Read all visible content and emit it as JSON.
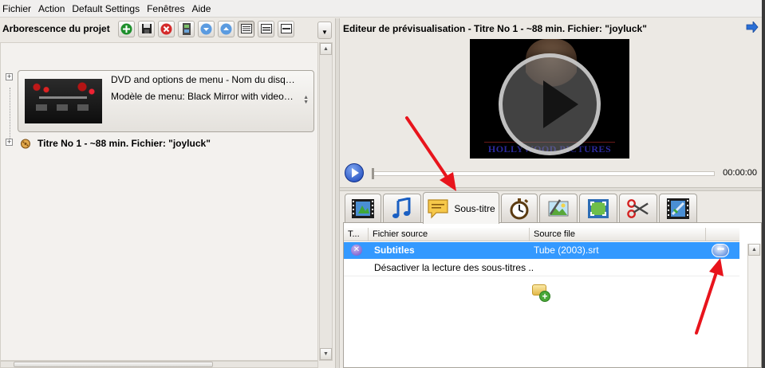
{
  "menubar": {
    "items": [
      "Fichier",
      "Action",
      "Default Settings",
      "Fenêtres",
      "Aide"
    ]
  },
  "project_tree": {
    "title": "Arborescence du projet",
    "toolbar_icons": [
      "add-icon",
      "save-icon",
      "delete-icon",
      "film-strip-icon",
      "move-down-icon",
      "move-up-icon",
      "view-large-icon",
      "view-medium-icon",
      "view-small-icon"
    ],
    "menu_node": {
      "line1": "DVD and options de menu - Nom du disque: \"...",
      "line2": "Modèle de menu: Black Mirror with video in to..."
    },
    "title_node": {
      "label": "Titre No 1 - ~88 min. Fichier: \"joyluck\""
    }
  },
  "preview": {
    "title": "Editeur de prévisualisation - Titre No 1 - ~88 min. Fichier: \"joyluck\"",
    "video_caption": "HOLLYWOOD PICTURES",
    "time": "00:00:00",
    "position_fraction": 0.0
  },
  "editor_tabs": {
    "tabs": [
      {
        "name": "video",
        "icon": "film-icon",
        "label": ""
      },
      {
        "name": "audio",
        "icon": "music-note-icon",
        "label": ""
      },
      {
        "name": "subtitle",
        "icon": "speech-bubble-icon",
        "label": "Sous-titre",
        "active": true
      },
      {
        "name": "chapters",
        "icon": "stopwatch-icon",
        "label": ""
      },
      {
        "name": "picture",
        "icon": "image-edit-icon",
        "label": ""
      },
      {
        "name": "crop",
        "icon": "crop-frame-icon",
        "label": ""
      },
      {
        "name": "cut",
        "icon": "scissors-icon",
        "label": ""
      },
      {
        "name": "effects",
        "icon": "film-effects-icon",
        "label": ""
      }
    ]
  },
  "subtitle_list": {
    "columns": [
      "T...",
      "Fichier source",
      "Source file"
    ],
    "rows": [
      {
        "type_icon": "subtitle-file-icon",
        "fichier_source": "Subtitles",
        "source_file": "Tube (2003).srt",
        "selected": true
      },
      {
        "type_icon": "",
        "fichier_source": "Désactiver la lecture des sous-titres ...",
        "source_file": "",
        "selected": false
      }
    ],
    "add_icon": "add-subtitle-icon"
  },
  "colors": {
    "selection": "#3399ff",
    "annotation_arrow": "#e8141c",
    "play_button": "#1642b8"
  }
}
